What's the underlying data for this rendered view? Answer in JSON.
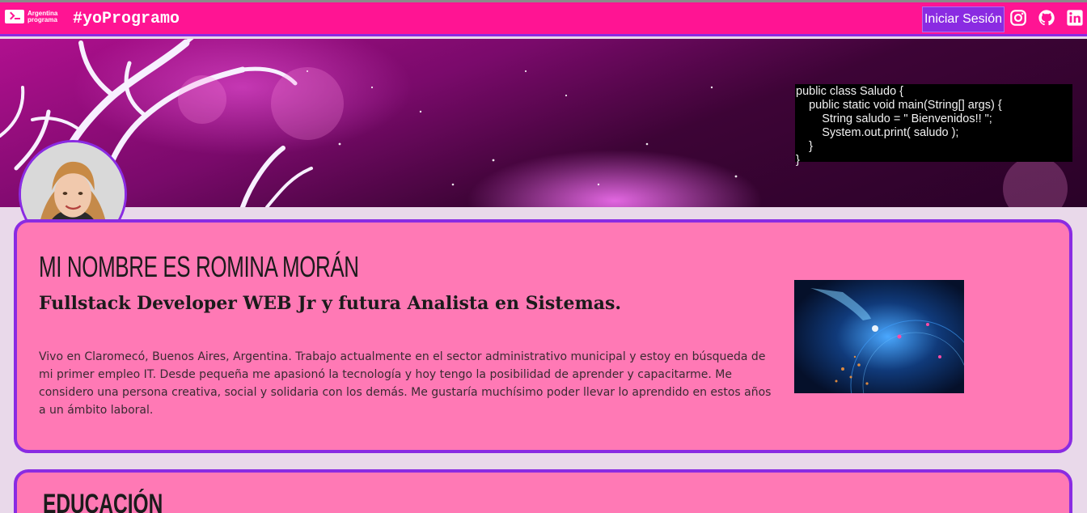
{
  "navbar": {
    "logo_text_line1": "Argentina",
    "logo_text_line2": "programa",
    "brand": "#yoProgramo",
    "login_label": "Iniciar Sesión",
    "social_icons": [
      "instagram-icon",
      "github-icon",
      "linkedin-icon"
    ]
  },
  "banner": {
    "code_lines": "public class Saludo {\n    public static void main(String[] args) {\n        String saludo = \" Bienvenidos!! \";\n        System.out.print( saludo );\n    }\n}"
  },
  "about": {
    "name": "MI NOMBRE ES ROMINA MORÁN",
    "subtitle": "Fullstack Developer WEB Jr y futura Analista en Sistemas.",
    "bio": "Vivo en Claromecó, Buenos Aires, Argentina. Trabajo actualmente en el sector administrativo municipal y estoy en búsqueda de mi primer empleo IT. Desde pequeña me apasionó la tecnología y hoy tengo la posibilidad de aprender y capacitarme. Me considero una persona creativa, social y solidaria con los demás. Me gustaría muchísimo poder llevar lo aprendido en estos años a un ámbito laboral."
  },
  "education": {
    "title": "EDUCACIÓN"
  },
  "colors": {
    "navbar": "#ff1493",
    "accent": "#8a2be2",
    "card": "#ff79b5",
    "page_bg": "#e9d9ea"
  }
}
